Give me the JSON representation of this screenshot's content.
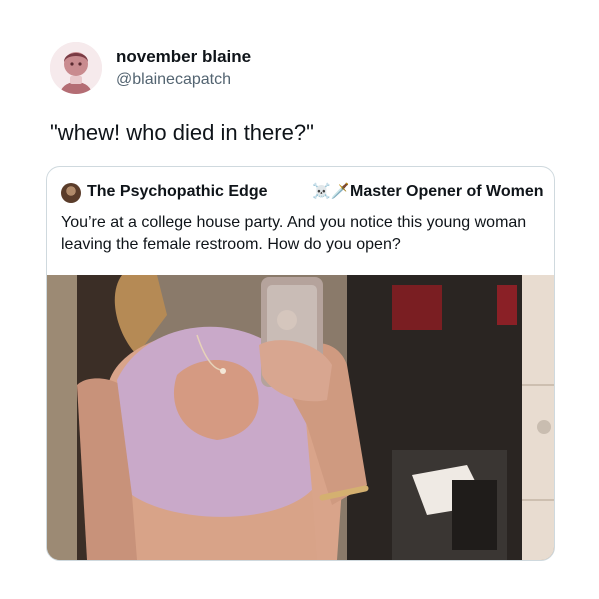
{
  "tweet": {
    "display_name": "november blaine",
    "handle": "@blainecapatch",
    "text": "\"whew! who died in there?\""
  },
  "quoted_tweet": {
    "display_name": "The Psychopathic Edge",
    "name_emojis": "☠️🗡️",
    "title": "Master Opener of Women",
    "text": "You’re at a college house party. And you notice this young woman leaving the female restroom. How do you open?"
  },
  "colors": {
    "text_primary": "#0f1419",
    "text_secondary": "#536471",
    "card_border": "#cfd9de"
  }
}
